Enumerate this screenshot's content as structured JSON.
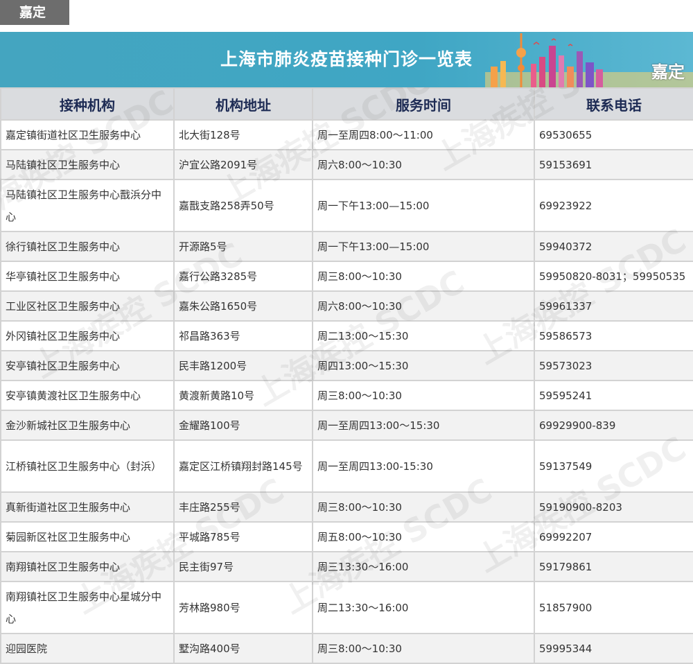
{
  "district_tag": "嘉定",
  "banner": {
    "title": "上海市肺炎疫苗接种门诊一览表",
    "district": "嘉定"
  },
  "table": {
    "headers": [
      "接种机构",
      "机构地址",
      "服务时间",
      "联系电话"
    ],
    "rows": [
      [
        "嘉定镇街道社区卫生服务中心",
        "北大街128号",
        "周一至周四8:00～11:00",
        "69530655"
      ],
      [
        "马陆镇社区卫生服务中心",
        "沪宜公路2091号",
        "周六8:00～10:30",
        "59153691"
      ],
      [
        "马陆镇社区卫生服务中心戬浜分中心",
        "嘉戬支路258弄50号",
        "周一下午13:00—15:00",
        "69923922"
      ],
      [
        "徐行镇社区卫生服务中心",
        "开源路5号",
        "周一下午13:00—15:00",
        "59940372"
      ],
      [
        "华亭镇社区卫生服务中心",
        "嘉行公路3285号",
        "周三8:00～10:30",
        "59950820-8031；59950535"
      ],
      [
        "工业区社区卫生服务中心",
        "嘉朱公路1650号",
        "周六8:00～10:30",
        "59961337"
      ],
      [
        "外冈镇社区卫生服务中心",
        "祁昌路363号",
        "周二13:00～15:30",
        "59586573"
      ],
      [
        "安亭镇社区卫生服务中心",
        "民丰路1200号",
        "周四13:00～15:30",
        "59573023"
      ],
      [
        "安亭镇黄渡社区卫生服务中心",
        "黄渡新黄路10号",
        "周三8:00～10:30",
        "59595241"
      ],
      [
        "金沙新城社区卫生服务中心",
        "金耀路100号",
        "周一至周四13:00～15:30",
        "69929900-839"
      ],
      [
        "江桥镇社区卫生服务中心（封浜）",
        "嘉定区江桥镇翔封路145号",
        "周一至周四13:00-15:30",
        "59137549"
      ],
      [
        "真新街道社区卫生服务中心",
        "丰庄路255号",
        "周三8:00～10:30",
        "59190900-8203"
      ],
      [
        "菊园新区社区卫生服务中心",
        "平城路785号",
        "周五8:00～10:30",
        "69992207"
      ],
      [
        "南翔镇社区卫生服务中心",
        "民主街97号",
        "周三13:30～16:00",
        "59179861"
      ],
      [
        "南翔镇社区卫生服务中心星城分中心",
        "芳林路980号",
        "周二13:30～16:00",
        "51857900"
      ],
      [
        "迎园医院",
        "墅沟路400号",
        "周三8:00～10:30",
        "59995344"
      ]
    ]
  },
  "watermark_text": "上海疾控 SCDC",
  "colors": {
    "banner": "#44a5c0",
    "header_bg": "#dadcdf",
    "header_text": "#1d2b54",
    "tag_bg": "#6d6d6d"
  }
}
